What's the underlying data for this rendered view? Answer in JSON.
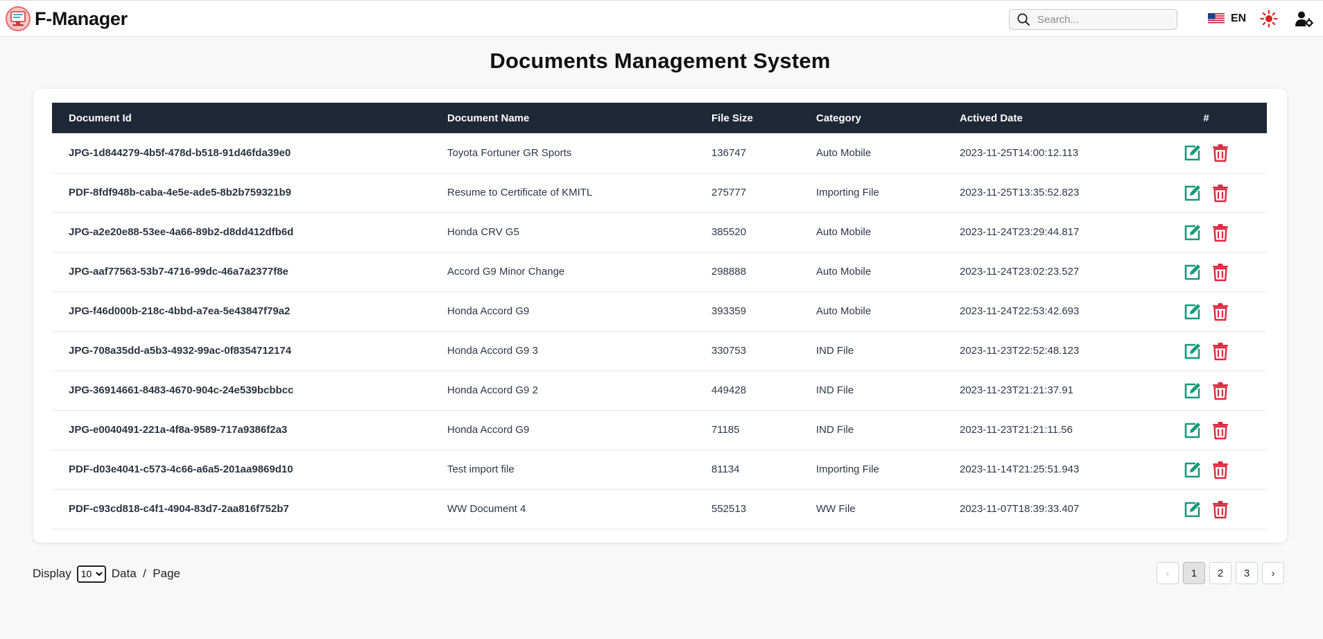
{
  "header": {
    "app_name": "F-Manager",
    "search_placeholder": "Search...",
    "language": "EN",
    "icons": [
      "app-logo-icon",
      "search-icon",
      "us-flag-icon",
      "sun-icon",
      "user-settings-icon"
    ]
  },
  "page": {
    "title": "Documents Management System"
  },
  "table": {
    "columns": [
      "Document Id",
      "Document Name",
      "File Size",
      "Category",
      "Actived Date",
      "#"
    ],
    "rows": [
      {
        "id": "JPG-1d844279-4b5f-478d-b518-91d46fda39e0",
        "name": "Toyota Fortuner GR Sports",
        "size": "136747",
        "category": "Auto Mobile",
        "date": "2023-11-25T14:00:12.113"
      },
      {
        "id": "PDF-8fdf948b-caba-4e5e-ade5-8b2b759321b9",
        "name": "Resume to Certificate of KMITL",
        "size": "275777",
        "category": "Importing File",
        "date": "2023-11-25T13:35:52.823"
      },
      {
        "id": "JPG-a2e20e88-53ee-4a66-89b2-d8dd412dfb6d",
        "name": "Honda CRV G5",
        "size": "385520",
        "category": "Auto Mobile",
        "date": "2023-11-24T23:29:44.817"
      },
      {
        "id": "JPG-aaf77563-53b7-4716-99dc-46a7a2377f8e",
        "name": "Accord G9 Minor Change",
        "size": "298888",
        "category": "Auto Mobile",
        "date": "2023-11-24T23:02:23.527"
      },
      {
        "id": "JPG-f46d000b-218c-4bbd-a7ea-5e43847f79a2",
        "name": "Honda Accord G9",
        "size": "393359",
        "category": "Auto Mobile",
        "date": "2023-11-24T22:53:42.693"
      },
      {
        "id": "JPG-708a35dd-a5b3-4932-99ac-0f8354712174",
        "name": "Honda Accord G9 3",
        "size": "330753",
        "category": "IND File",
        "date": "2023-11-23T22:52:48.123"
      },
      {
        "id": "JPG-36914661-8483-4670-904c-24e539bcbbcc",
        "name": "Honda Accord G9 2",
        "size": "449428",
        "category": "IND File",
        "date": "2023-11-23T21:21:37.91"
      },
      {
        "id": "JPG-e0040491-221a-4f8a-9589-717a9386f2a3",
        "name": "Honda Accord G9",
        "size": "71185",
        "category": "IND File",
        "date": "2023-11-23T21:21:11.56"
      },
      {
        "id": "PDF-d03e4041-c573-4c66-a6a5-201aa9869d10",
        "name": "Test import file",
        "size": "81134",
        "category": "Importing File",
        "date": "2023-11-14T21:25:51.943"
      },
      {
        "id": "PDF-c93cd818-c4f1-4904-83d7-2aa816f752b7",
        "name": "WW Document 4",
        "size": "552513",
        "category": "WW File",
        "date": "2023-11-07T18:39:33.407"
      }
    ],
    "row_actions": [
      "edit-icon",
      "delete-icon"
    ]
  },
  "pagination": {
    "display_label": "Display",
    "page_size": "10",
    "page_size_options": [
      "10"
    ],
    "data_per_page_label": "Data  /  Page",
    "prev_label": "‹",
    "pages": [
      "1",
      "2",
      "3"
    ],
    "active_page": "1",
    "next_label": "›"
  },
  "colors": {
    "table_header_bg": "#1e2836",
    "edit_icon": "#159a7a",
    "delete_icon": "#e0263d",
    "sun_icon": "#e02020",
    "page_bg": "#f8f8f8"
  }
}
